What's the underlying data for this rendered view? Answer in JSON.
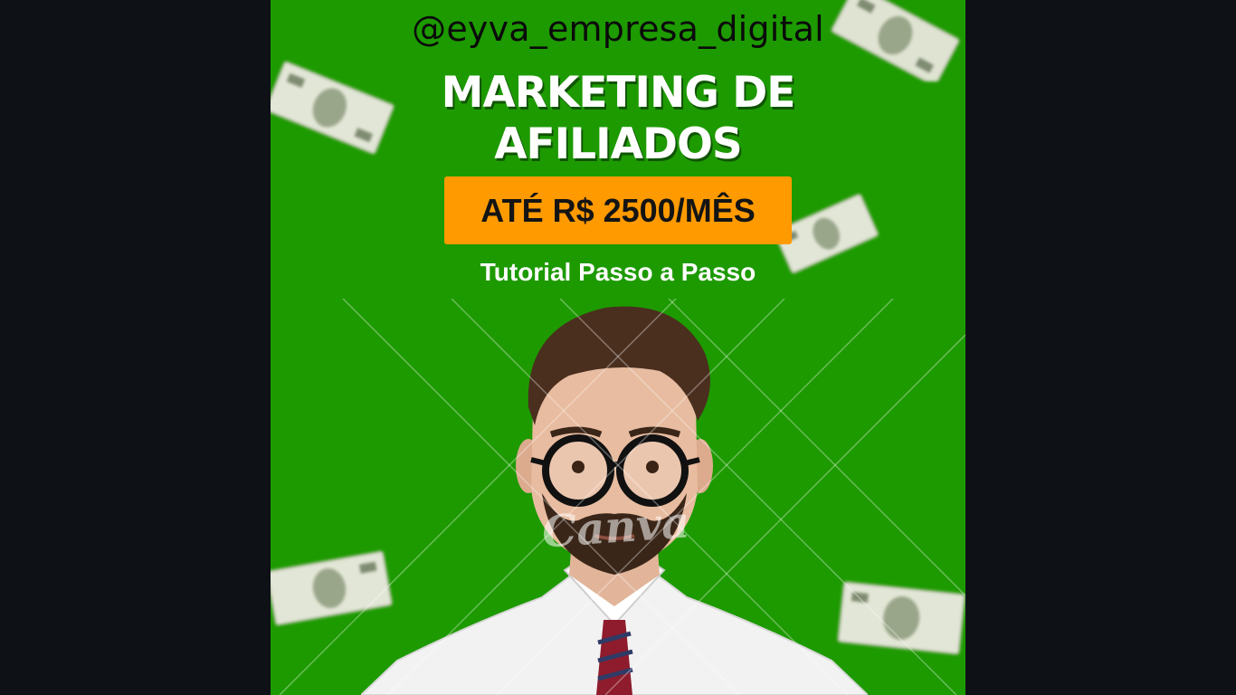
{
  "post": {
    "handle": "@eyva_empresa_digital",
    "headline_line1": "MARKETING DE",
    "headline_line2": "AFILIADOS",
    "price_badge": "ATÉ R$ 2500/MÊS",
    "subtitle": "Tutorial Passo a Passo",
    "watermark": "Canva"
  },
  "colors": {
    "background": "#1d9a00",
    "badge": "#ff9a00",
    "viewer_bg": "#0e1217"
  },
  "icons": [
    "dollar-bill-image",
    "person-photo"
  ]
}
